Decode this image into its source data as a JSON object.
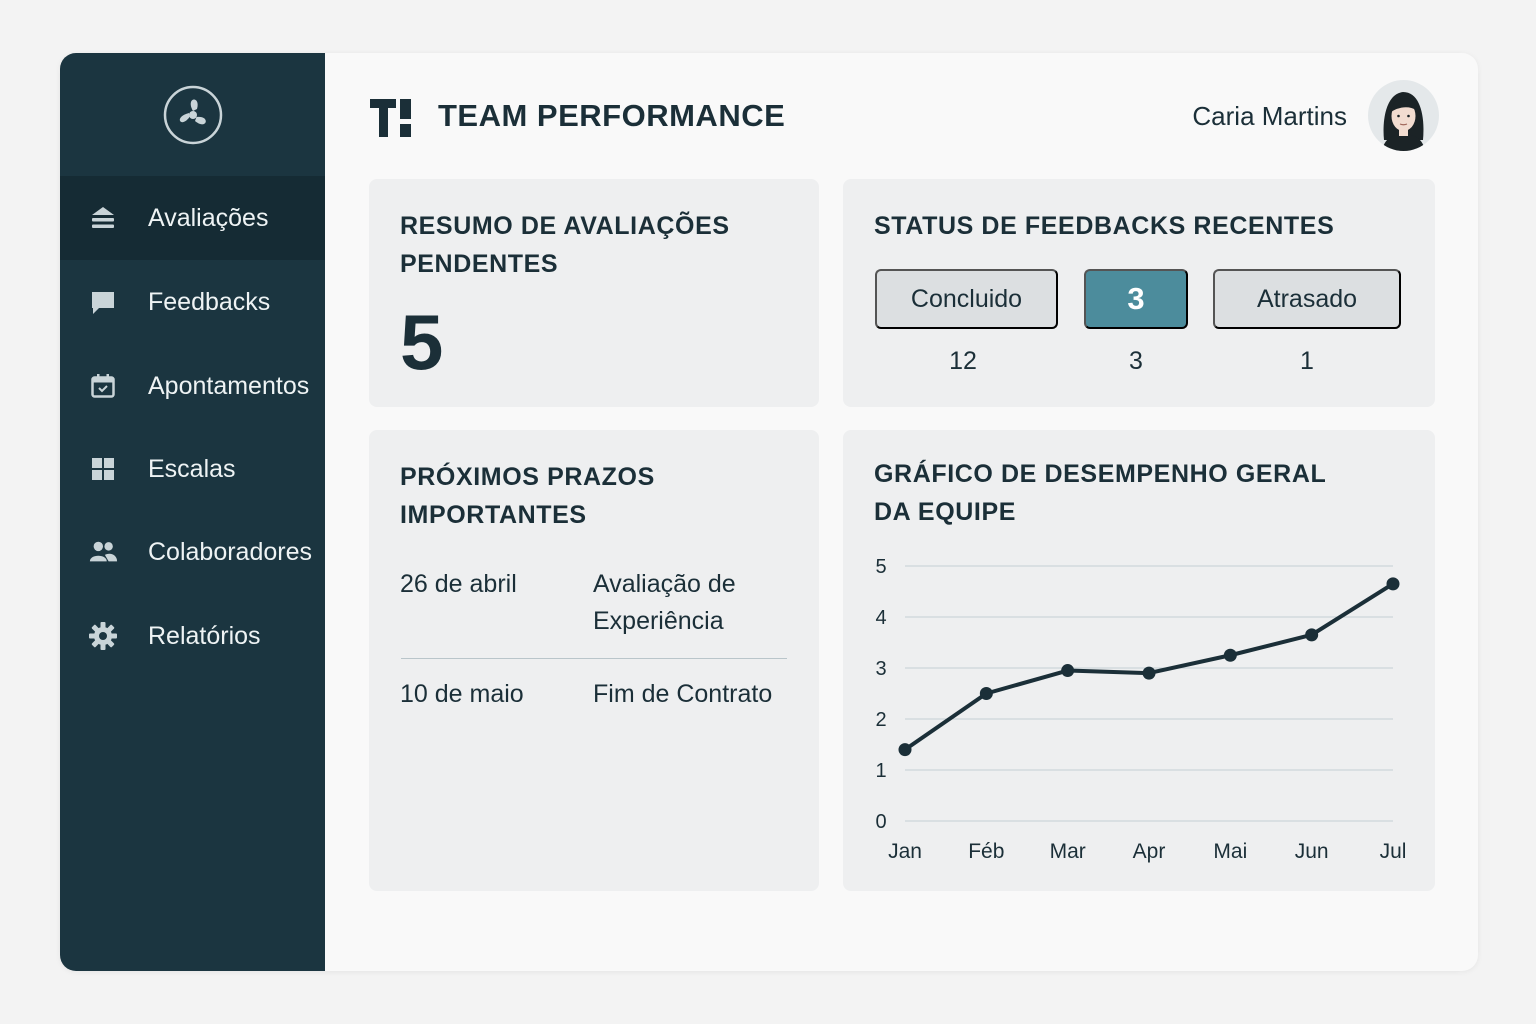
{
  "app": {
    "title": "TEAM PERFORMANCE",
    "user_name": "Caria Martins"
  },
  "sidebar": {
    "items": [
      {
        "label": "Avaliações",
        "icon": "stack-icon",
        "active": true
      },
      {
        "label": "Feedbacks",
        "icon": "chat-bubble-icon",
        "active": false
      },
      {
        "label": "Apontamentos",
        "icon": "calendar-icon",
        "active": false
      },
      {
        "label": "Escalas",
        "icon": "grid-icon",
        "active": false
      },
      {
        "label": "Colaboradores",
        "icon": "users-icon",
        "active": false
      },
      {
        "label": "Relatórios",
        "icon": "gear-icon",
        "active": false
      }
    ]
  },
  "pending": {
    "title_line1": "RESUMO DE AVALIAÇÕES",
    "title_line2": "PENDENTES",
    "value": "5"
  },
  "feedback_status": {
    "title": "STATUS DE FEEDBACKS RECENTES",
    "statuses": [
      {
        "label": "Concluido",
        "count": "12"
      },
      {
        "label": "3",
        "count": "3"
      },
      {
        "label": "Atrasado",
        "count": "1"
      }
    ]
  },
  "deadlines": {
    "title_line1": "PRÓXIMOS PRAZOS",
    "title_line2": "IMPORTANTES",
    "items": [
      {
        "date": "26 de abril",
        "event_line1": "Avaliação de",
        "event_line2": "Experiência"
      },
      {
        "date": "10 de maio",
        "event_line1": "Fim de Contrato",
        "event_line2": ""
      }
    ]
  },
  "performance": {
    "title_line1": "GRÁFICO DE DESEMPENHO GERAL",
    "title_line2": "DA EQUIPE"
  },
  "colors": {
    "sidebar_bg": "#1b3540",
    "accent": "#4c8c9c",
    "line": "#1b2f38"
  },
  "chart_data": {
    "type": "line",
    "categories": [
      "Jan",
      "Féb",
      "Mar",
      "Apr",
      "Mai",
      "Jun",
      "Jul"
    ],
    "series": [
      {
        "values": [
          1.4,
          2.5,
          2.95,
          2.9,
          3.25,
          3.65,
          4.65
        ]
      }
    ],
    "ylim": [
      0,
      5
    ],
    "yticks": [
      "0",
      "1",
      "2",
      "3",
      "4",
      "5"
    ],
    "grid": true,
    "title": "",
    "xlabel": "",
    "ylabel": ""
  }
}
